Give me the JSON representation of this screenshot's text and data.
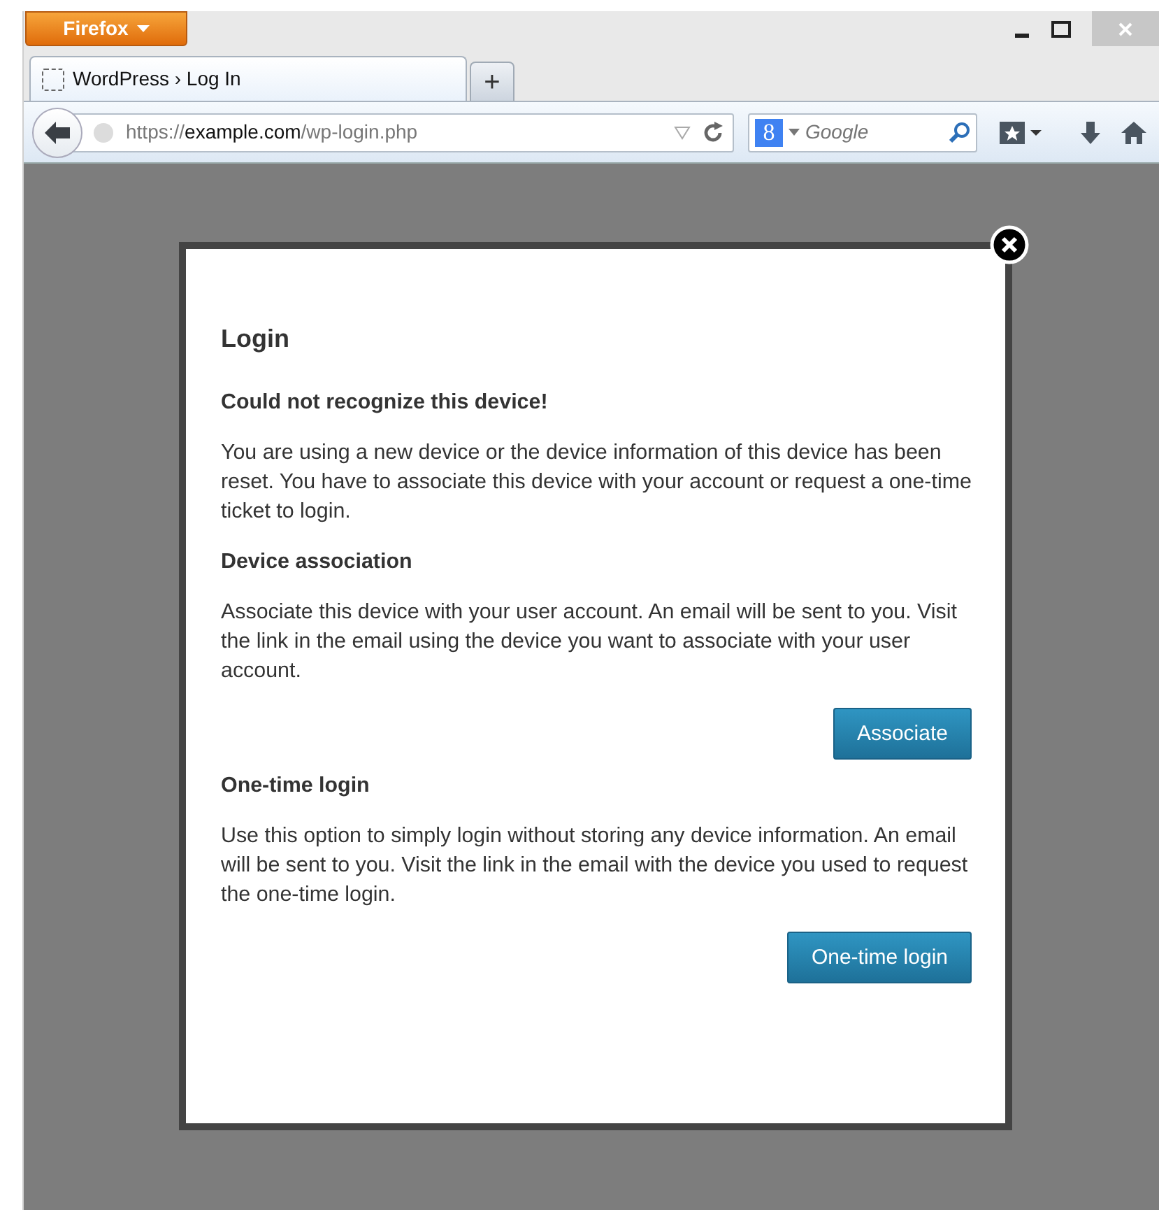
{
  "browser": {
    "menu_button": "Firefox",
    "tabs": [
      {
        "label": "WordPress › Log In",
        "selected": true
      }
    ],
    "new_tab": "+",
    "address": {
      "scheme": "https://",
      "host": "example.com",
      "path": "/wp-login.php"
    },
    "search": {
      "engine_badge": "8",
      "placeholder": "Google"
    }
  },
  "dialog": {
    "title": "Login",
    "intro_heading": "Could not recognize this device!",
    "intro_text": "You are using a new device or the device information of this device has been reset. You have to associate this device with your account or request a one-time ticket to login.",
    "sections": [
      {
        "heading": "Device association",
        "text": "Associate this device with your user account. An email will be sent to you. Visit the link in the email using the device you want to associate with your user account.",
        "button": "Associate"
      },
      {
        "heading": "One-time login",
        "text": "Use this option to simply login without storing any device information. An email will be sent to you. Visit the link in the email with the device you used to request the one-time login.",
        "button": "One-time login"
      }
    ]
  }
}
